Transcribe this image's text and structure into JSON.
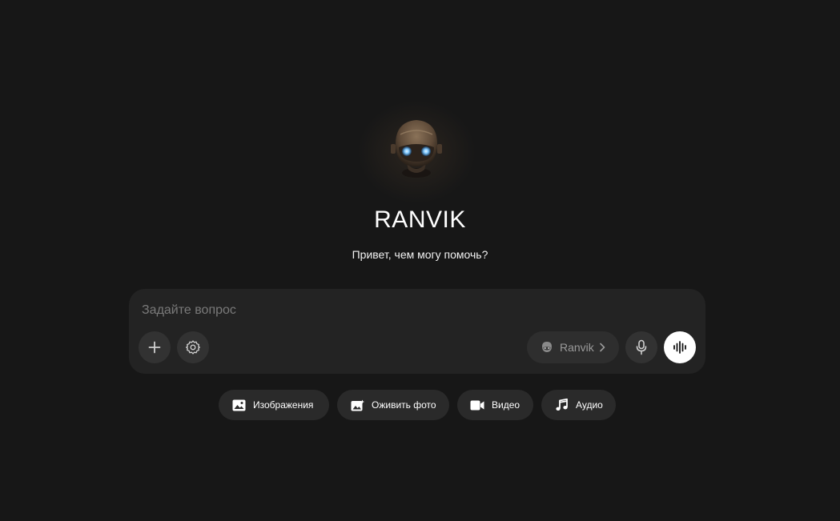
{
  "assistant": {
    "name": "RANVIK",
    "greeting": "Привет, чем могу помочь?"
  },
  "composer": {
    "placeholder": "Задайте вопрос",
    "value": "",
    "model_label": "Ranvik",
    "icons": {
      "add": "plus-icon",
      "settings": "gear-icon",
      "model": "robot-head-icon",
      "mic": "microphone-icon",
      "voice": "voice-waveform-icon"
    }
  },
  "quick_actions": [
    {
      "label": "Изображения",
      "icon": "image-icon"
    },
    {
      "label": "Оживить фото",
      "icon": "animate-photo-icon"
    },
    {
      "label": "Видео",
      "icon": "video-camera-icon"
    },
    {
      "label": "Аудио",
      "icon": "music-note-icon"
    }
  ],
  "colors": {
    "background": "#171717",
    "composer": "#232323",
    "button": "#323232",
    "chip": "#2a2a2a",
    "accent_eye": "#7fc8ff"
  }
}
